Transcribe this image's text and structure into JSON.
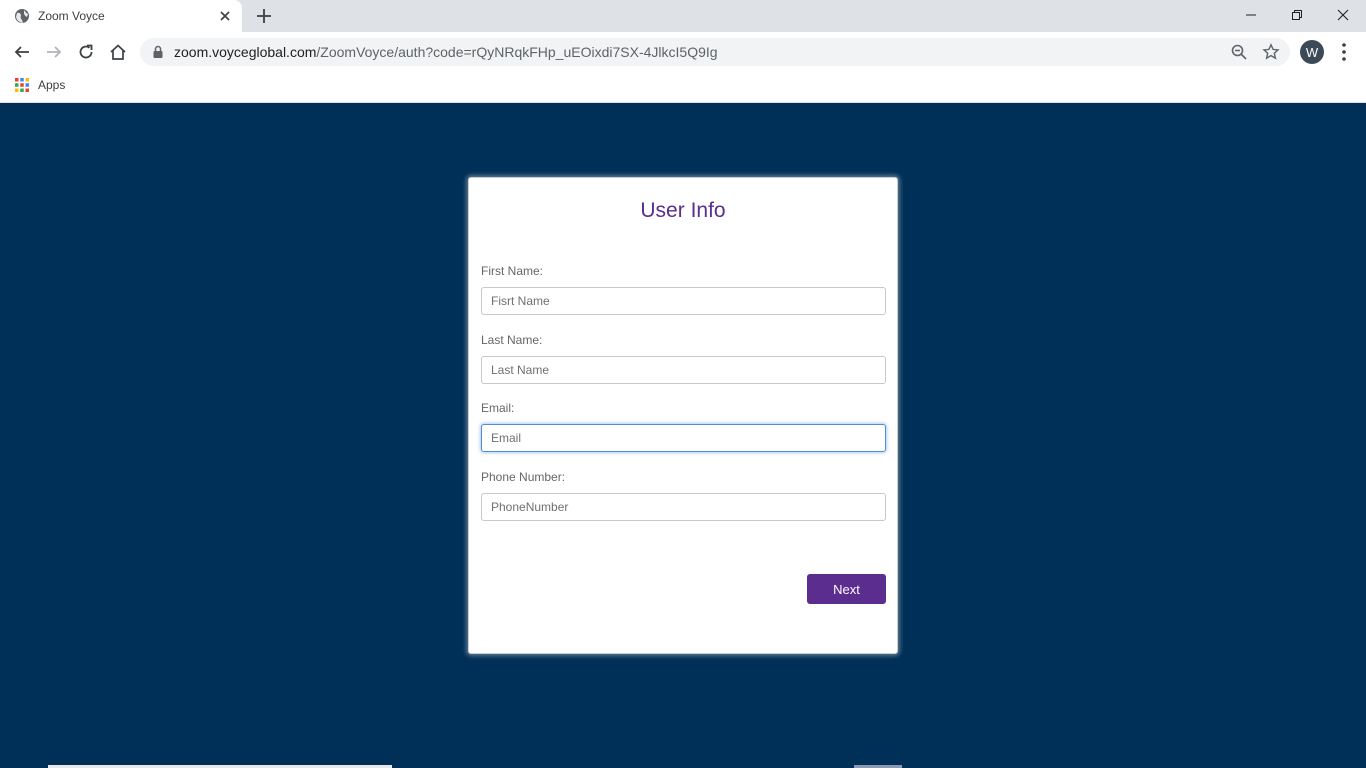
{
  "browser": {
    "tab_title": "Zoom Voyce",
    "url_host": "zoom.voyceglobal.com",
    "url_path": "/ZoomVoyce/auth?code=rQyNRqkFHp_uEOixdi7SX-4JlkcI5Q9Ig",
    "profile_initial": "W",
    "bookmarks": {
      "apps_label": "Apps"
    }
  },
  "form": {
    "title": "User Info",
    "first_name": {
      "label": "First Name:",
      "placeholder": "Fisrt Name"
    },
    "last_name": {
      "label": "Last Name:",
      "placeholder": "Last Name"
    },
    "email": {
      "label": "Email:",
      "placeholder": "Email"
    },
    "phone": {
      "label": "Phone Number:",
      "placeholder": "PhoneNumber"
    },
    "next_label": "Next"
  },
  "colors": {
    "page_background": "#002f57",
    "accent": "#5b2d8e",
    "focus_ring": "#4c8fd6"
  }
}
